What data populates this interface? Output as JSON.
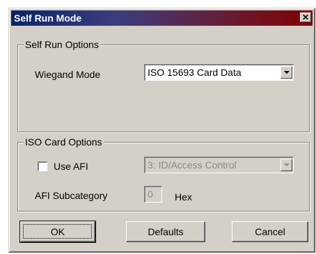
{
  "window": {
    "title": "Self Run Mode",
    "close_glyph": "✕"
  },
  "self_run_options": {
    "legend": "Self Run Options",
    "wiegand_label": "Wiegand Mode",
    "wiegand_value": "ISO 15693 Card Data"
  },
  "iso_card_options": {
    "legend": "ISO Card Options",
    "use_afi_label": "Use AFI",
    "use_afi_checked": false,
    "afi_value": "3: ID/Access Control",
    "afi_subcategory_label": "AFI Subcategory",
    "afi_subcategory_value": "0",
    "hex_label": "Hex"
  },
  "buttons": {
    "ok": "OK",
    "defaults": "Defaults",
    "cancel": "Cancel"
  }
}
